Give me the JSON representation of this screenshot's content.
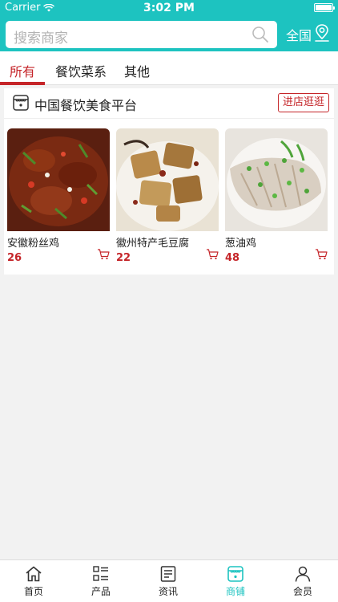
{
  "status_bar": {
    "carrier": "Carrier",
    "time": "3:02 PM"
  },
  "search": {
    "placeholder": "搜索商家"
  },
  "city": "全国",
  "tabs": [
    {
      "label": "所有",
      "active": true
    },
    {
      "label": "餐饮菜系",
      "active": false
    },
    {
      "label": "其他",
      "active": false
    }
  ],
  "shop": {
    "name": "中国餐饮美食平台",
    "visit_label": "进店逛逛",
    "products": [
      {
        "name": "安徽粉丝鸡",
        "price": "26"
      },
      {
        "name": "徽州特产毛豆腐",
        "price": "22"
      },
      {
        "name": "葱油鸡",
        "price": "48"
      }
    ]
  },
  "tabbar": [
    {
      "label": "首页",
      "icon": "home-icon",
      "active": false
    },
    {
      "label": "产品",
      "icon": "list-icon",
      "active": false
    },
    {
      "label": "资讯",
      "icon": "news-icon",
      "active": false
    },
    {
      "label": "商铺",
      "icon": "store-icon",
      "active": true
    },
    {
      "label": "会员",
      "icon": "user-icon",
      "active": false
    }
  ],
  "colors": {
    "brand": "#1dc3c0",
    "accent": "#c52529"
  }
}
